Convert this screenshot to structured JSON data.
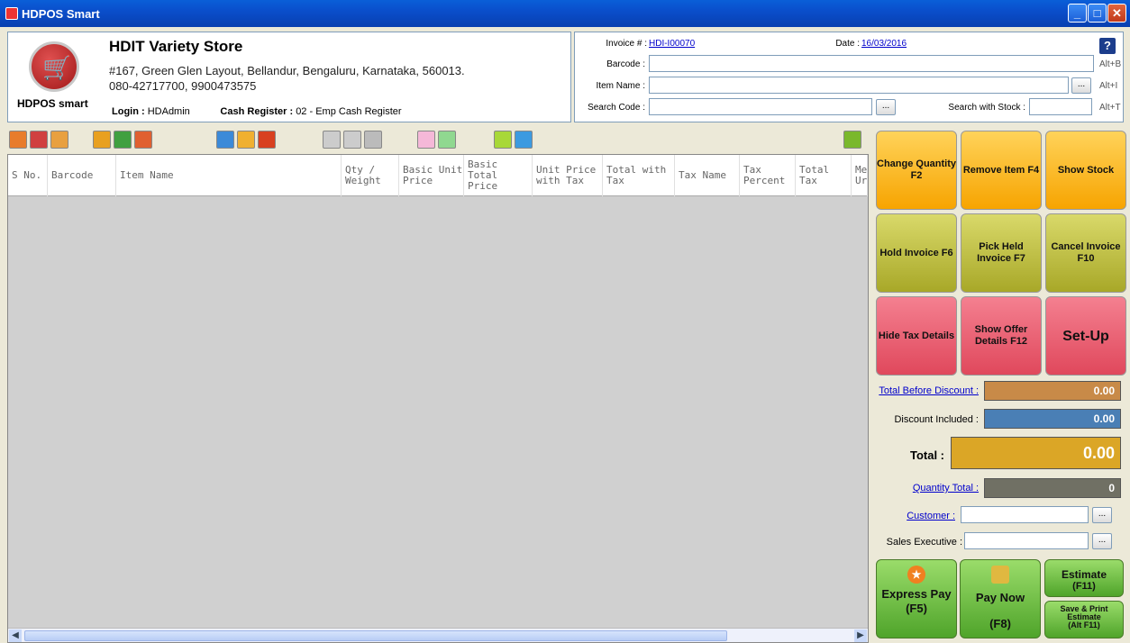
{
  "window": {
    "title": "HDPOS Smart",
    "buttons": [
      "_",
      "□",
      "X"
    ]
  },
  "store": {
    "logo_label": "HDPOS smart",
    "name": "HDIT Variety Store",
    "address": "#167, Green Glen Layout, Bellandur, Bengaluru, Karnataka, 560013.",
    "phones": "080-42717700, 9900473575",
    "login_label": "Login :",
    "login_value": "HDAdmin",
    "register_label": "Cash Register :",
    "register_value": "02 - Emp Cash Register"
  },
  "invoice": {
    "invoice_label": "Invoice # :",
    "invoice_no": "HDI-I00070",
    "date_label": "Date :",
    "date": "16/03/2016",
    "barcode_label": "Barcode :",
    "barcode_hotkey": "Alt+B",
    "item_name_label": "Item Name :",
    "item_name_hotkey": "Alt+I",
    "search_code_label": "Search Code :",
    "search_stock_label": "Search with Stock :",
    "search_stock_hotkey": "Alt+T",
    "browse": "...",
    "help": "?"
  },
  "grid": {
    "columns": [
      "S No.",
      "Barcode",
      "Item Name",
      "Qty / Weight",
      "Basic Unit Price",
      "Basic Total Price",
      "Unit Price with Tax",
      "Total with Tax",
      "Tax Name",
      "Tax Percent",
      "Total Tax",
      "Me Ur"
    ],
    "rows": []
  },
  "actions": {
    "change_qty": "Change Quantity F2",
    "remove_item": "Remove Item F4",
    "show_stock": "Show Stock",
    "hold_invoice": "Hold Invoice F6",
    "pick_held": "Pick Held Invoice F7",
    "cancel_invoice": "Cancel Invoice F10",
    "hide_tax": "Hide Tax Details",
    "show_offer": "Show Offer Details F12",
    "setup": "Set-Up"
  },
  "summary": {
    "total_before_discount_label": "Total Before Discount :",
    "total_before_discount": "0.00",
    "discount_label": "Discount Included :",
    "discount": "0.00",
    "total_label": "Total :",
    "total": "0.00",
    "qty_total_label": "Quantity Total :",
    "qty_total": "0",
    "customer_label": "Customer :",
    "sales_exec_label": "Sales Executive :"
  },
  "payment": {
    "express_pay": "Express Pay",
    "express_key": "(F5)",
    "pay_now": "Pay Now",
    "pay_now_key": "(F8)",
    "estimate": "Estimate",
    "estimate_key": "(F11)",
    "save_print": "Save & Print Estimate",
    "save_print_key": "(Alt F11)"
  },
  "colors": {
    "total_before": "#c88a48",
    "discount": "#4a7fb5",
    "total": "#dba626",
    "qty": "#707064"
  }
}
